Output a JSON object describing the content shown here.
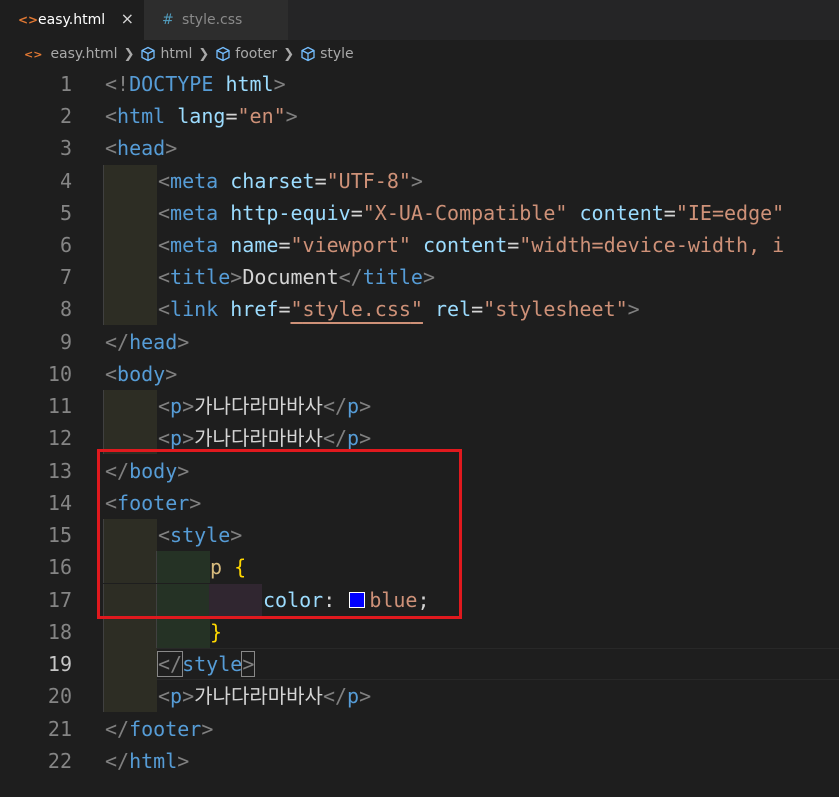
{
  "tabs": [
    {
      "label": "easy.html",
      "icon": "<>",
      "active": true,
      "close": "×"
    },
    {
      "label": "style.css",
      "icon": "#",
      "active": false
    }
  ],
  "breadcrumb": [
    "easy.html",
    "html",
    "footer",
    "style"
  ],
  "line_numbers": [
    "1",
    "2",
    "3",
    "4",
    "5",
    "6",
    "7",
    "8",
    "9",
    "10",
    "11",
    "12",
    "13",
    "14",
    "15",
    "16",
    "17",
    "18",
    "19",
    "20",
    "21",
    "22"
  ],
  "current_line": "19",
  "colors": {
    "swatch": "#0000ff",
    "highlight_box": "#e0191e"
  },
  "code": {
    "l1": {
      "open": "<!",
      "kw": "DOCTYPE",
      "name": "html",
      "close": ">"
    },
    "l2": {
      "open": "<",
      "tag": "html",
      "attr": "lang",
      "eq": "=",
      "val": "\"en\"",
      "close": ">"
    },
    "l3": {
      "open": "<",
      "tag": "head",
      "close": ">"
    },
    "l4": {
      "open": "<",
      "tag": "meta",
      "attr": "charset",
      "eq": "=",
      "val": "\"UTF-8\"",
      "close": ">"
    },
    "l5": {
      "open": "<",
      "tag": "meta",
      "attr1": "http-equiv",
      "eq1": "=",
      "val1": "\"X-UA-Compatible\"",
      "attr2": "content",
      "eq2": "=",
      "val2": "\"IE=edge\""
    },
    "l6": {
      "open": "<",
      "tag": "meta",
      "attr1": "name",
      "eq1": "=",
      "val1": "\"viewport\"",
      "attr2": "content",
      "eq2": "=",
      "val2": "\"width=device-width, i"
    },
    "l7": {
      "open": "<",
      "tag": "title",
      "close": ">",
      "text": "Document",
      "open2": "</",
      "tag2": "title",
      "close2": ">"
    },
    "l8": {
      "open": "<",
      "tag": "link",
      "attr1": "href",
      "eq1": "=",
      "q1": "\"",
      "val1": "style.css",
      "q2": "\"",
      "attr2": "rel",
      "eq2": "=",
      "val2": "\"stylesheet\"",
      "close": ">"
    },
    "l9": {
      "open": "</",
      "tag": "head",
      "close": ">"
    },
    "l10": {
      "open": "<",
      "tag": "body",
      "close": ">"
    },
    "l11": {
      "open": "<",
      "tag": "p",
      "close": ">",
      "text": "가나다라마바사",
      "open2": "</",
      "tag2": "p",
      "close2": ">"
    },
    "l12": {
      "open": "<",
      "tag": "p",
      "close": ">",
      "text": "가나다라마바사",
      "open2": "</",
      "tag2": "p",
      "close2": ">"
    },
    "l13": {
      "open": "</",
      "tag": "body",
      "close": ">"
    },
    "l14": {
      "open": "<",
      "tag": "footer",
      "close": ">"
    },
    "l15": {
      "open": "<",
      "tag": "style",
      "close": ">"
    },
    "l16": {
      "selector": "p",
      "brace": "{"
    },
    "l17": {
      "prop": "color",
      "colon": ":",
      "value": "blue",
      "semi": ";"
    },
    "l18": {
      "brace": "}"
    },
    "l19": {
      "open": "</",
      "tag": "style",
      "close": ">"
    },
    "l20": {
      "open": "<",
      "tag": "p",
      "close": ">",
      "text": "가나다라마바사",
      "open2": "</",
      "tag2": "p",
      "close2": ">"
    },
    "l21": {
      "open": "</",
      "tag": "footer",
      "close": ">"
    },
    "l22": {
      "open": "</",
      "tag": "html",
      "close": ">"
    }
  }
}
